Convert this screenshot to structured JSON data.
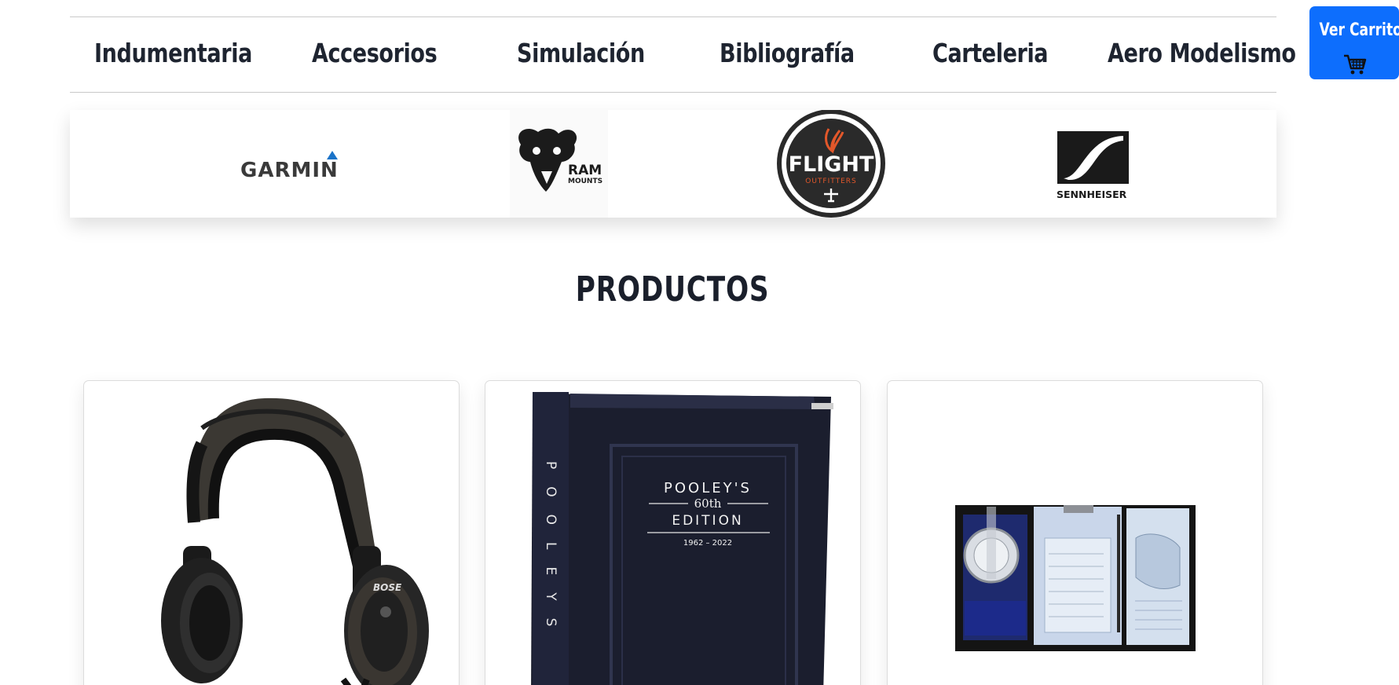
{
  "nav": {
    "items": [
      {
        "label": "Indumentaria"
      },
      {
        "label": "Accesorios"
      },
      {
        "label": "Simulación"
      },
      {
        "label": "Bibliografía"
      },
      {
        "label": "Carteleria"
      },
      {
        "label": "Aero Modelismo"
      }
    ]
  },
  "cart": {
    "label": "Ver Carrito",
    "icon": "shopping-cart-icon",
    "color": "#0d6efd"
  },
  "brands": {
    "garmin": {
      "text": "GARMIN",
      "accent": "#1a73c8"
    },
    "ram": {
      "text": "RAM",
      "sub": "MOUNTS"
    },
    "flight": {
      "text": "FLIGHT",
      "sub": "OUTFITTERS",
      "accent": "#e2572a"
    },
    "sennheiser": {
      "text": "SENNHEISER"
    }
  },
  "section": {
    "title": "PRODUCTOS"
  },
  "products": [
    {
      "name": "Bose aviation headset",
      "brand_mark": "BOSE"
    },
    {
      "name": "Pooley's binder",
      "cover": {
        "brand": "POOLEY'S",
        "edition": "60th",
        "edition_word": "EDITION",
        "years": "1962 – 2022",
        "spine": "POOLEYS"
      }
    },
    {
      "name": "Flight kneeboard with computer"
    }
  ]
}
